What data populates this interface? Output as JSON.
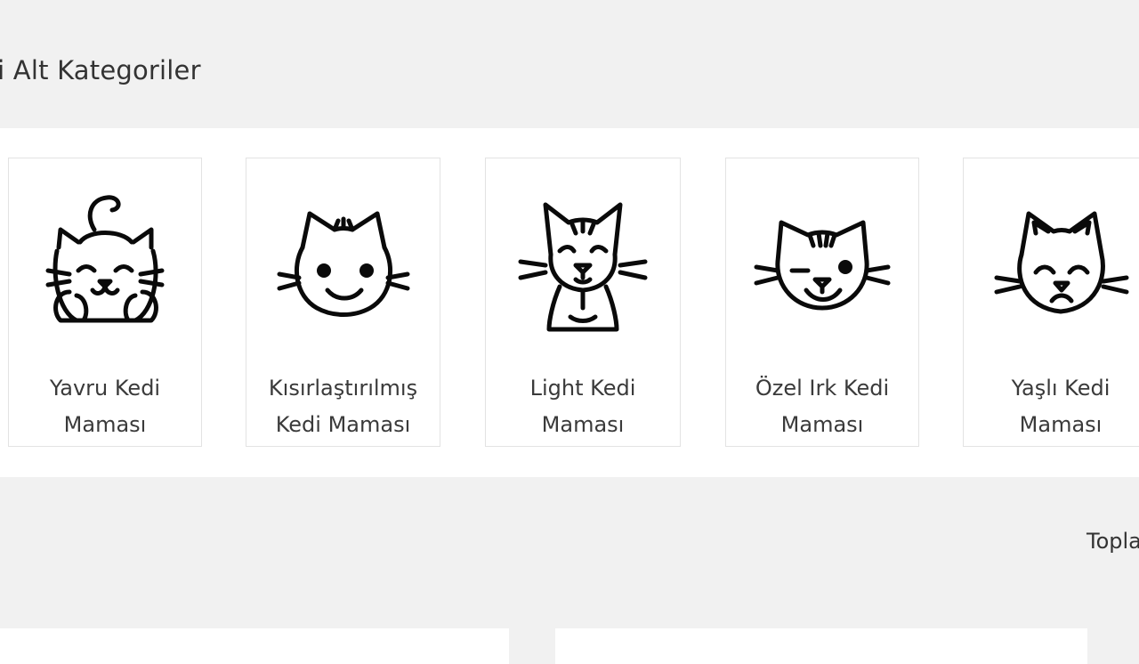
{
  "section": {
    "title": "gili Alt Kategoriler"
  },
  "categories": [
    {
      "label": "Yavru Kedi Maması",
      "icon": "kitten-icon"
    },
    {
      "label": "Kısırlaştırılmış Kedi Maması",
      "icon": "smiling-cat-icon"
    },
    {
      "label": "Light Kedi Maması",
      "icon": "sitting-cat-icon"
    },
    {
      "label": "Özel Irk Kedi Maması",
      "icon": "winking-tabby-cat-icon"
    },
    {
      "label": "Yaşlı Kedi Maması",
      "icon": "senior-cat-icon"
    }
  ],
  "footer": {
    "total_text": "Topla"
  }
}
